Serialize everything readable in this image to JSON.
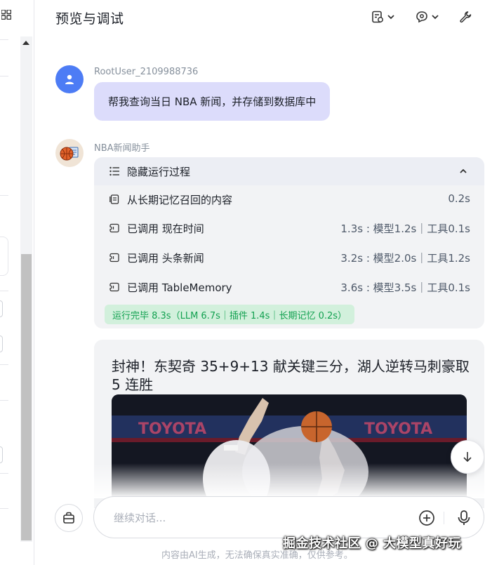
{
  "header": {
    "title": "预览与调试",
    "buttons": [
      "doc-settings-icon",
      "model-icon",
      "wrench-icon"
    ]
  },
  "messages": {
    "user": {
      "name": "RootUser_2109988736",
      "text": "帮我查询当日 NBA 新闻，并存储到数据库中"
    },
    "bot": {
      "name": "NBA新闻助手",
      "run": {
        "toggle_label": "隐藏运行过程",
        "steps": [
          {
            "icon": "memory-icon",
            "label": "从长期记忆召回的内容",
            "time": "0.2s"
          },
          {
            "icon": "plugin-call-icon",
            "label": "已调用 现在时间",
            "time": "1.3s : 模型1.2s｜工具0.1s"
          },
          {
            "icon": "plugin-call-icon",
            "label": "已调用 头条新闻",
            "time": "3.2s : 模型2.0s｜工具1.2s"
          },
          {
            "icon": "plugin-call-icon",
            "label": "已调用 TableMemory",
            "time": "3.6s : 模型3.5s｜工具0.1s"
          }
        ],
        "summary": "运行完毕 8.3s（LLM 6.7s｜插件 1.4s｜长期记忆 0.2s）"
      },
      "news": {
        "title": "封神！东契奇 35+9+13 献关键三分，湖人逆转马刺豪取 5 连胜",
        "image_banner_text": "TOYOTA"
      }
    }
  },
  "composer": {
    "placeholder": "继续对话..."
  },
  "footer": {
    "disclaimer": "内容由AI生成，无法确保真实准确，仅供参考。",
    "watermark": "掘金技术社区 @ 大模型真好玩"
  },
  "colors": {
    "user_avatar": "#4d7cf5",
    "user_bubble": "#dcdcfb",
    "card_bg": "#f2f3f5",
    "success_bg": "#d2f0dc",
    "success_text": "#12a150"
  }
}
